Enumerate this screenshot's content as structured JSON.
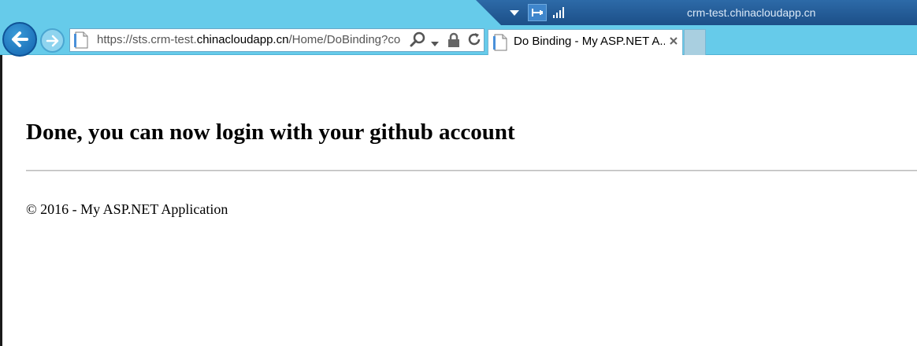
{
  "window": {
    "title": "crm-test.chinacloudapp.cn"
  },
  "address_bar": {
    "url_prefix": "https://sts.crm-test.",
    "url_domain": "chinacloudapp.cn",
    "url_suffix": "/Home/DoBinding?co"
  },
  "tab": {
    "title": "Do Binding - My ASP.NET A..."
  },
  "page": {
    "heading": "Done, you can now login with your github account",
    "footer": "© 2016 - My ASP.NET Application"
  },
  "colors": {
    "chrome": "#66cbea",
    "titlebar": "#1c4f88",
    "back_button": "#1364b0"
  }
}
